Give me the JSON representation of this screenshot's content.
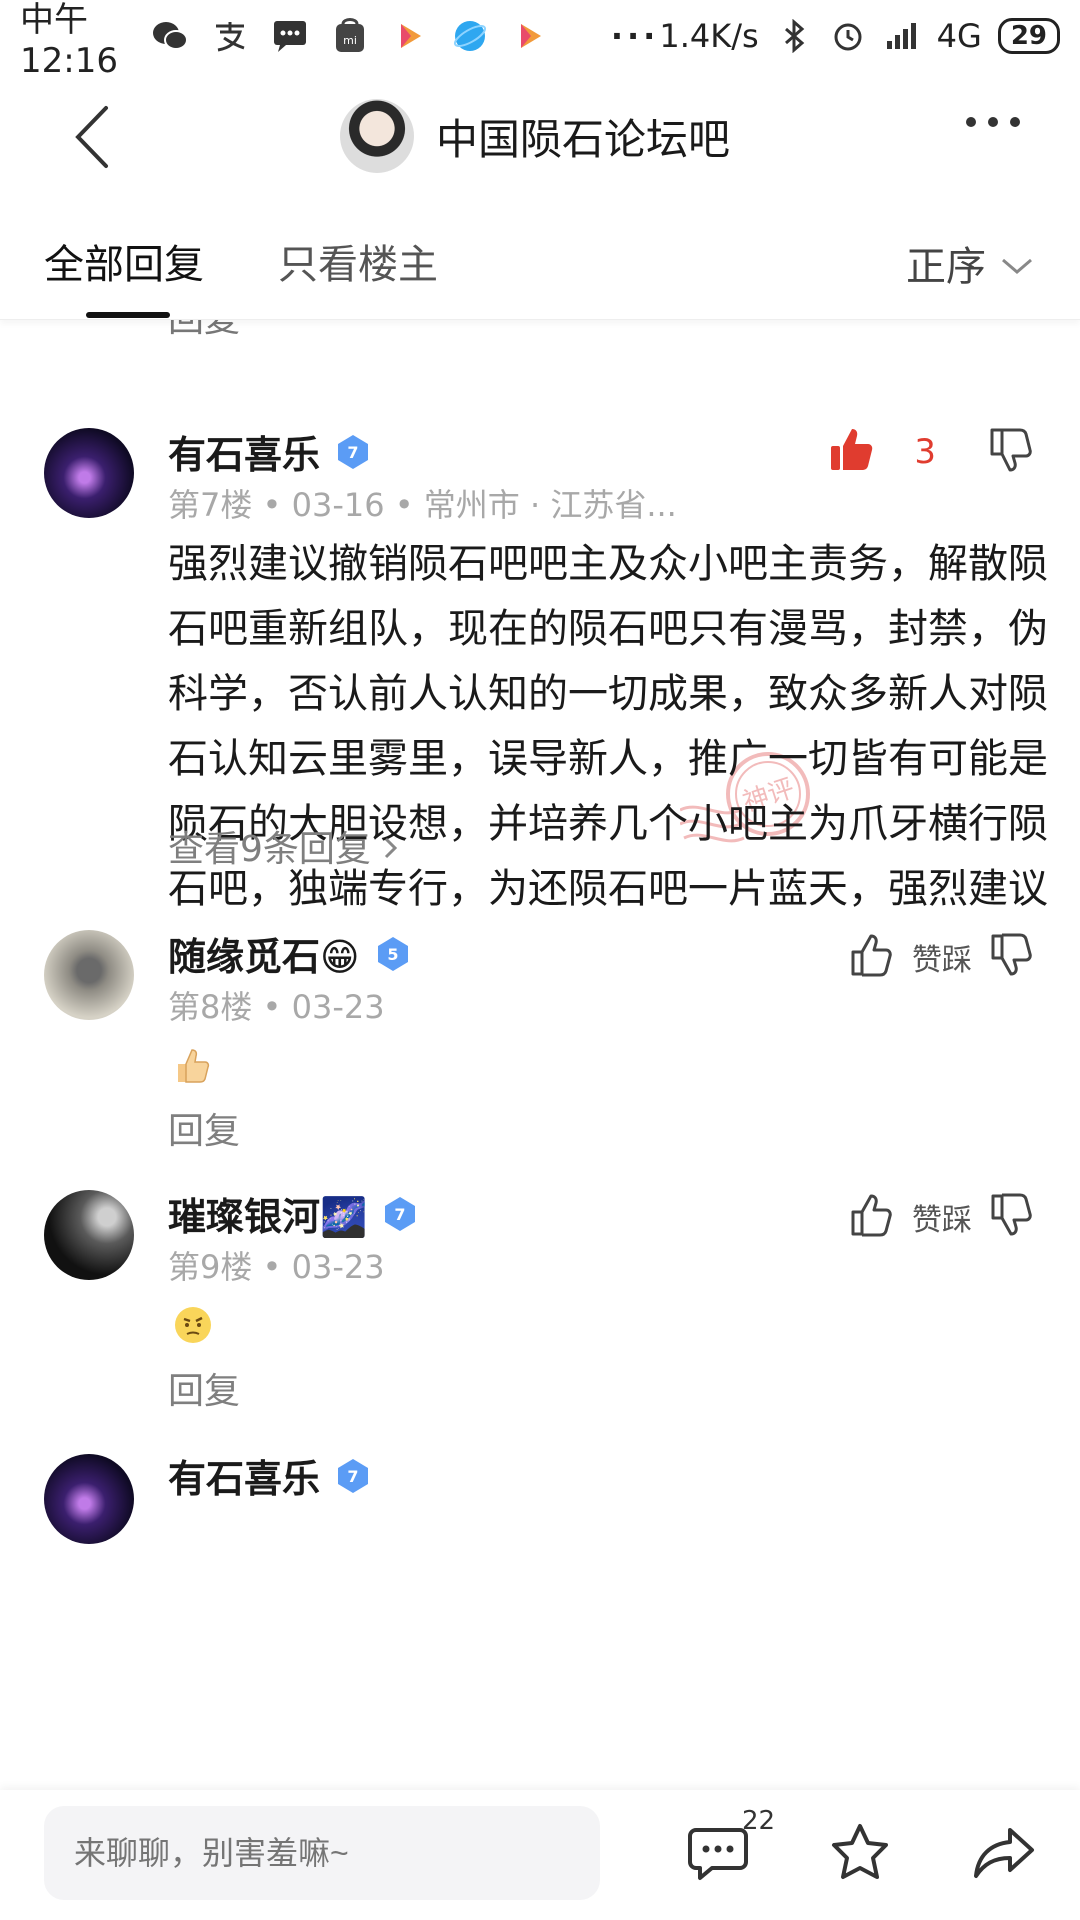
{
  "status_bar": {
    "time": "中午12:16",
    "network_speed": "1.4K/s",
    "signal": "4G",
    "battery": "29",
    "overflow": "···"
  },
  "header": {
    "forum_title": "中国陨石论坛吧"
  },
  "tabs": {
    "all_replies": "全部回复",
    "op_only": "只看楼主",
    "sort": "正序"
  },
  "partial_top_reply": "回复",
  "posts": [
    {
      "username": "有石喜乐",
      "level": "7",
      "floor": "第7楼",
      "date": "03-16",
      "location": "常州市 · 江苏省...",
      "text": "强烈建议撤销陨石吧吧主及众小吧主责务，解散陨石吧重新组队，现在的陨石吧只有漫骂，封禁，伪科学，否认前人认知的一切成果，致众多新人对陨石认知云里雾里，误导新人，推广一切皆有可能是陨石的大胆设想，并培养几个小吧主为爪牙横行陨石吧，独端专行，为还陨石吧一片蓝天，强烈建议",
      "likes": "3",
      "stamp_text": "神评",
      "view_replies": "查看9条回复"
    },
    {
      "username": "随缘觅石😁",
      "level": "5",
      "floor": "第8楼",
      "date": "03-23",
      "reply": "回复",
      "zan_label": "赞踩"
    },
    {
      "username": "璀璨银河🌌",
      "level": "7",
      "floor": "第9楼",
      "date": "03-23",
      "reply": "回复",
      "zan_label": "赞踩"
    },
    {
      "username": "有石喜乐",
      "level": "7"
    }
  ],
  "bottom_bar": {
    "input_placeholder": "来聊聊，别害羞嘛~",
    "comment_count": "22"
  },
  "colors": {
    "accent_red": "#e03c2f",
    "badge_blue": "#5b9cf5",
    "meta_gray": "#a8a8a8"
  }
}
